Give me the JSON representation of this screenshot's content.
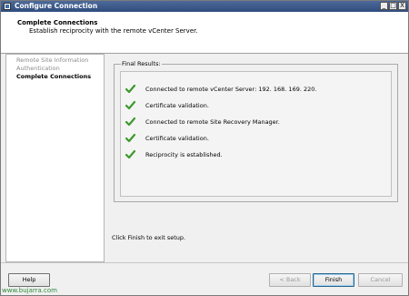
{
  "window": {
    "title": "Configure Connection",
    "controls": {
      "minimize": "_",
      "maximize": "□",
      "close": "X"
    }
  },
  "header": {
    "title": "Complete Connections",
    "description": "Establish reciprocity with the remote vCenter Server."
  },
  "sidebar": {
    "items": [
      {
        "label": "Remote Site Information",
        "state": "done"
      },
      {
        "label": "Authentication",
        "state": "done"
      },
      {
        "label": "Complete Connections",
        "state": "current"
      }
    ]
  },
  "results": {
    "legend": "Final Results:",
    "items": [
      {
        "text": "Connected to remote vCenter Server: 192. 168. 169. 220.",
        "icon": "green-check-icon"
      },
      {
        "text": "Certificate validation.",
        "icon": "green-check-icon"
      },
      {
        "text": "Connected  to remote Site Recovery Manager.",
        "icon": "green-check-icon"
      },
      {
        "text": "Certificate validation.",
        "icon": "green-check-icon"
      },
      {
        "text": "Reciprocity is established.",
        "icon": "green-check-icon"
      }
    ]
  },
  "finish_note": "Click Finish to exit setup.",
  "buttons": {
    "help": "Help",
    "back": "< Back",
    "finish": "Finish",
    "cancel": "Cancel"
  },
  "watermark": "www.bujarra.com",
  "colors": {
    "titlebar": "#3a5a8c",
    "check": "#3c9a2c",
    "watermark": "#2e8b3a"
  }
}
